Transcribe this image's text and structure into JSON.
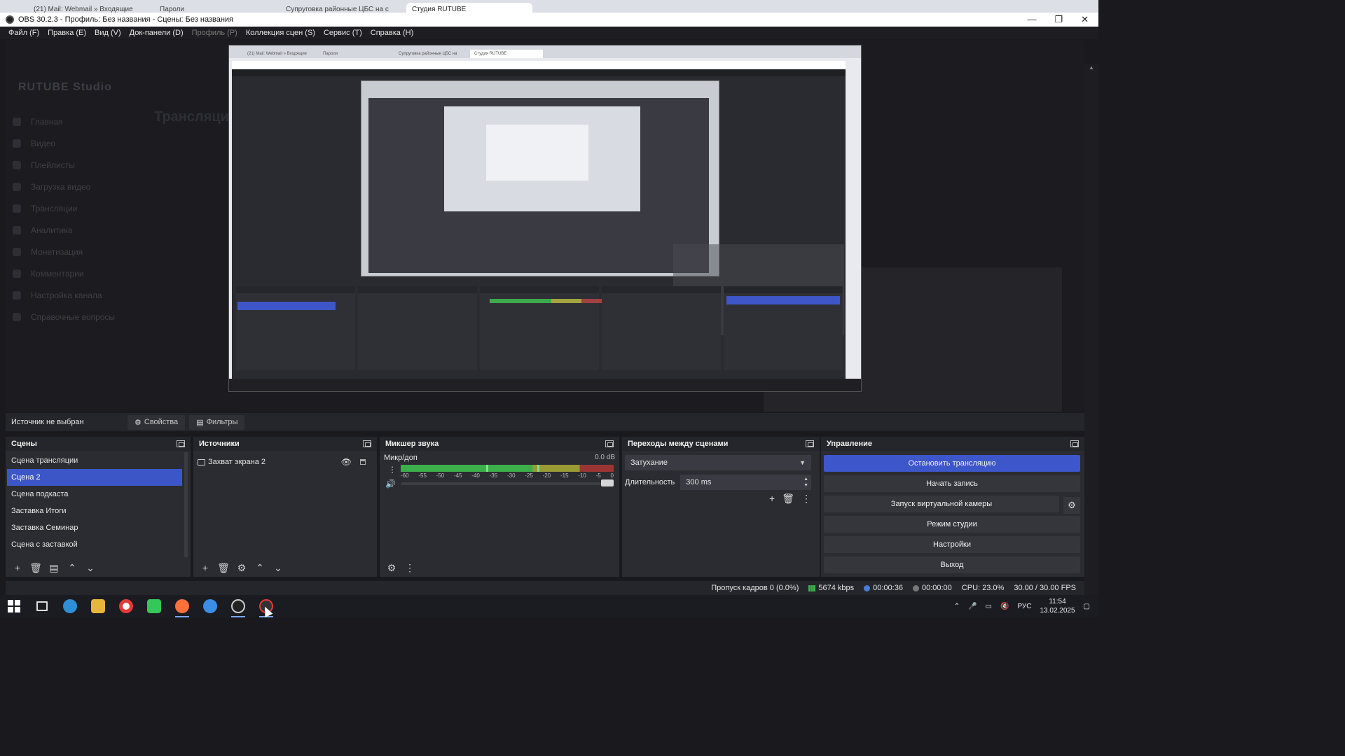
{
  "browser_tabs": [
    "(21) Mail: Webmail » Входящие",
    "Пароли",
    "Супруговка районные ЦБС на с",
    "Студия RUTUBE"
  ],
  "window": {
    "title": "OBS 30.2.3 - Профиль: Без названия - Сцены: Без названия",
    "controls": [
      "—",
      "❐",
      "✕"
    ]
  },
  "menu": [
    {
      "label": "Файл (F)",
      "disabled": false
    },
    {
      "label": "Правка (E)",
      "disabled": false
    },
    {
      "label": "Вид (V)",
      "disabled": false
    },
    {
      "label": "Док-панели (D)",
      "disabled": false
    },
    {
      "label": "Профиль (P)",
      "disabled": true
    },
    {
      "label": "Коллекция сцен (S)",
      "disabled": false
    },
    {
      "label": "Сервис (T)",
      "disabled": false
    },
    {
      "label": "Справка (H)",
      "disabled": false
    }
  ],
  "preview_ghost": {
    "logo": "RUTUBE Studio",
    "page_title": "Трансляции",
    "side_items": [
      "Главная",
      "Видео",
      "Плейлисты",
      "Загрузка видео",
      "Трансляции",
      "Аналитика",
      "Монетизация",
      "Комментарии",
      "Настройка канала",
      "Справочные вопросы"
    ]
  },
  "capture_tabs": [
    "(21) Mail: Webmail » Входящие",
    "Пароли",
    "Супруговка районные ЦБС на",
    "Студия RUTUBE"
  ],
  "source_toolbar": {
    "no_source": "Источник не выбран",
    "properties": "Свойства",
    "filters": "Фильтры"
  },
  "scenes": {
    "title": "Сцены",
    "items": [
      "Сцена трансляции",
      "Сцена 2",
      "Сцена подкаста",
      "Заставка Итоги",
      "Заставка Семинар",
      "Сцена с заставкой"
    ],
    "selected_index": 1
  },
  "sources": {
    "title": "Источники",
    "items": [
      "Захват экрана 2"
    ]
  },
  "mixer": {
    "title": "Микшер звука",
    "channel": "Микр/доп",
    "db": "0.0 dB",
    "ticks": [
      "-60",
      "-55",
      "-50",
      "-45",
      "-40",
      "-35",
      "-30",
      "-25",
      "-20",
      "-15",
      "-10",
      "-5",
      "0"
    ],
    "volume_fraction": 1.0
  },
  "transitions": {
    "title": "Переходы между сценами",
    "selected": "Затухание",
    "duration_label": "Длительность",
    "duration_value": "300 ms"
  },
  "controls": {
    "title": "Управление",
    "stop_stream": "Остановить трансляцию",
    "start_record": "Начать запись",
    "virtual_cam": "Запуск виртуальной камеры",
    "studio_mode": "Режим студии",
    "settings": "Настройки",
    "exit": "Выход"
  },
  "status": {
    "dropped": "Пропуск кадров 0 (0.0%)",
    "bitrate": "5674 kbps",
    "stream_time": "00:00:36",
    "record_time": "00:00:00",
    "cpu": "CPU: 23.0%",
    "fps": "30.00 / 30.00 FPS"
  },
  "taskbar": {
    "lang": "РУС",
    "time": "11:54",
    "date": "13.02.2025"
  },
  "colors": {
    "accent": "#3d56c9",
    "meter_green": "#3caf4b",
    "meter_yellow": "#9a9a35",
    "meter_red": "#9b3535"
  }
}
